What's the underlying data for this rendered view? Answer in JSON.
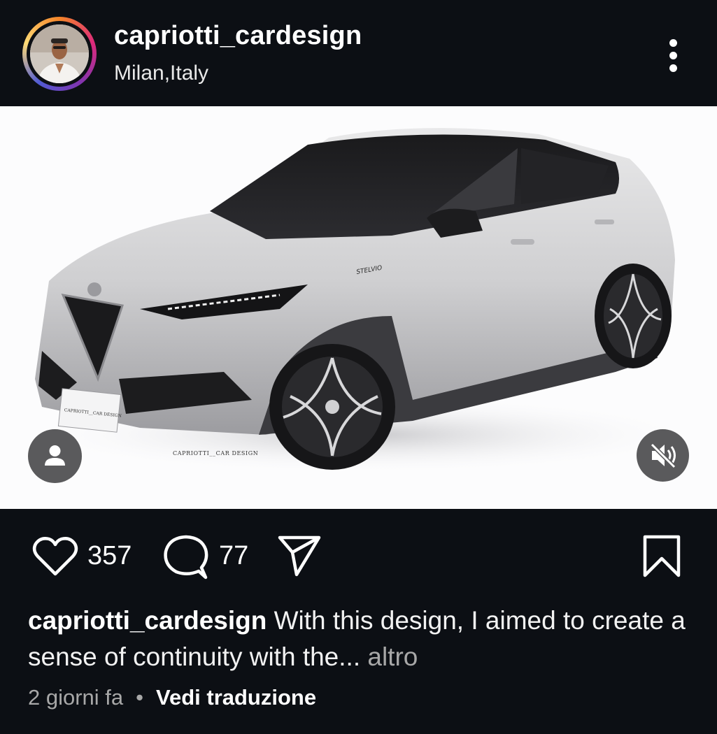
{
  "post": {
    "username": "capriotti_cardesign",
    "location": "Milan,Italy",
    "likes": "357",
    "comments": "77",
    "caption_user": "capriotti_cardesign",
    "caption_text": "With this design, I aimed to create a sense of continuity with the...",
    "caption_more": "altro",
    "time_ago": "2 giorni fa",
    "separator": "•",
    "translate_label": "Vedi traduzione"
  },
  "image": {
    "badge_text": "STELVIO",
    "watermark": "CAPRIOTTI__CAR DESIGN",
    "plate_text": "CAPRIOTTI__CAR DESIGN"
  },
  "icons": {
    "more": "more-vertical-icon",
    "like": "heart-icon",
    "comment": "comment-icon",
    "share": "send-icon",
    "save": "bookmark-icon",
    "tag": "user-tag-icon",
    "mute": "volume-mute-icon"
  },
  "colors": {
    "background": "#0c0f14",
    "text": "#ffffff",
    "muted": "#a8a8a8",
    "overlay_button": "#5a5a5c"
  }
}
